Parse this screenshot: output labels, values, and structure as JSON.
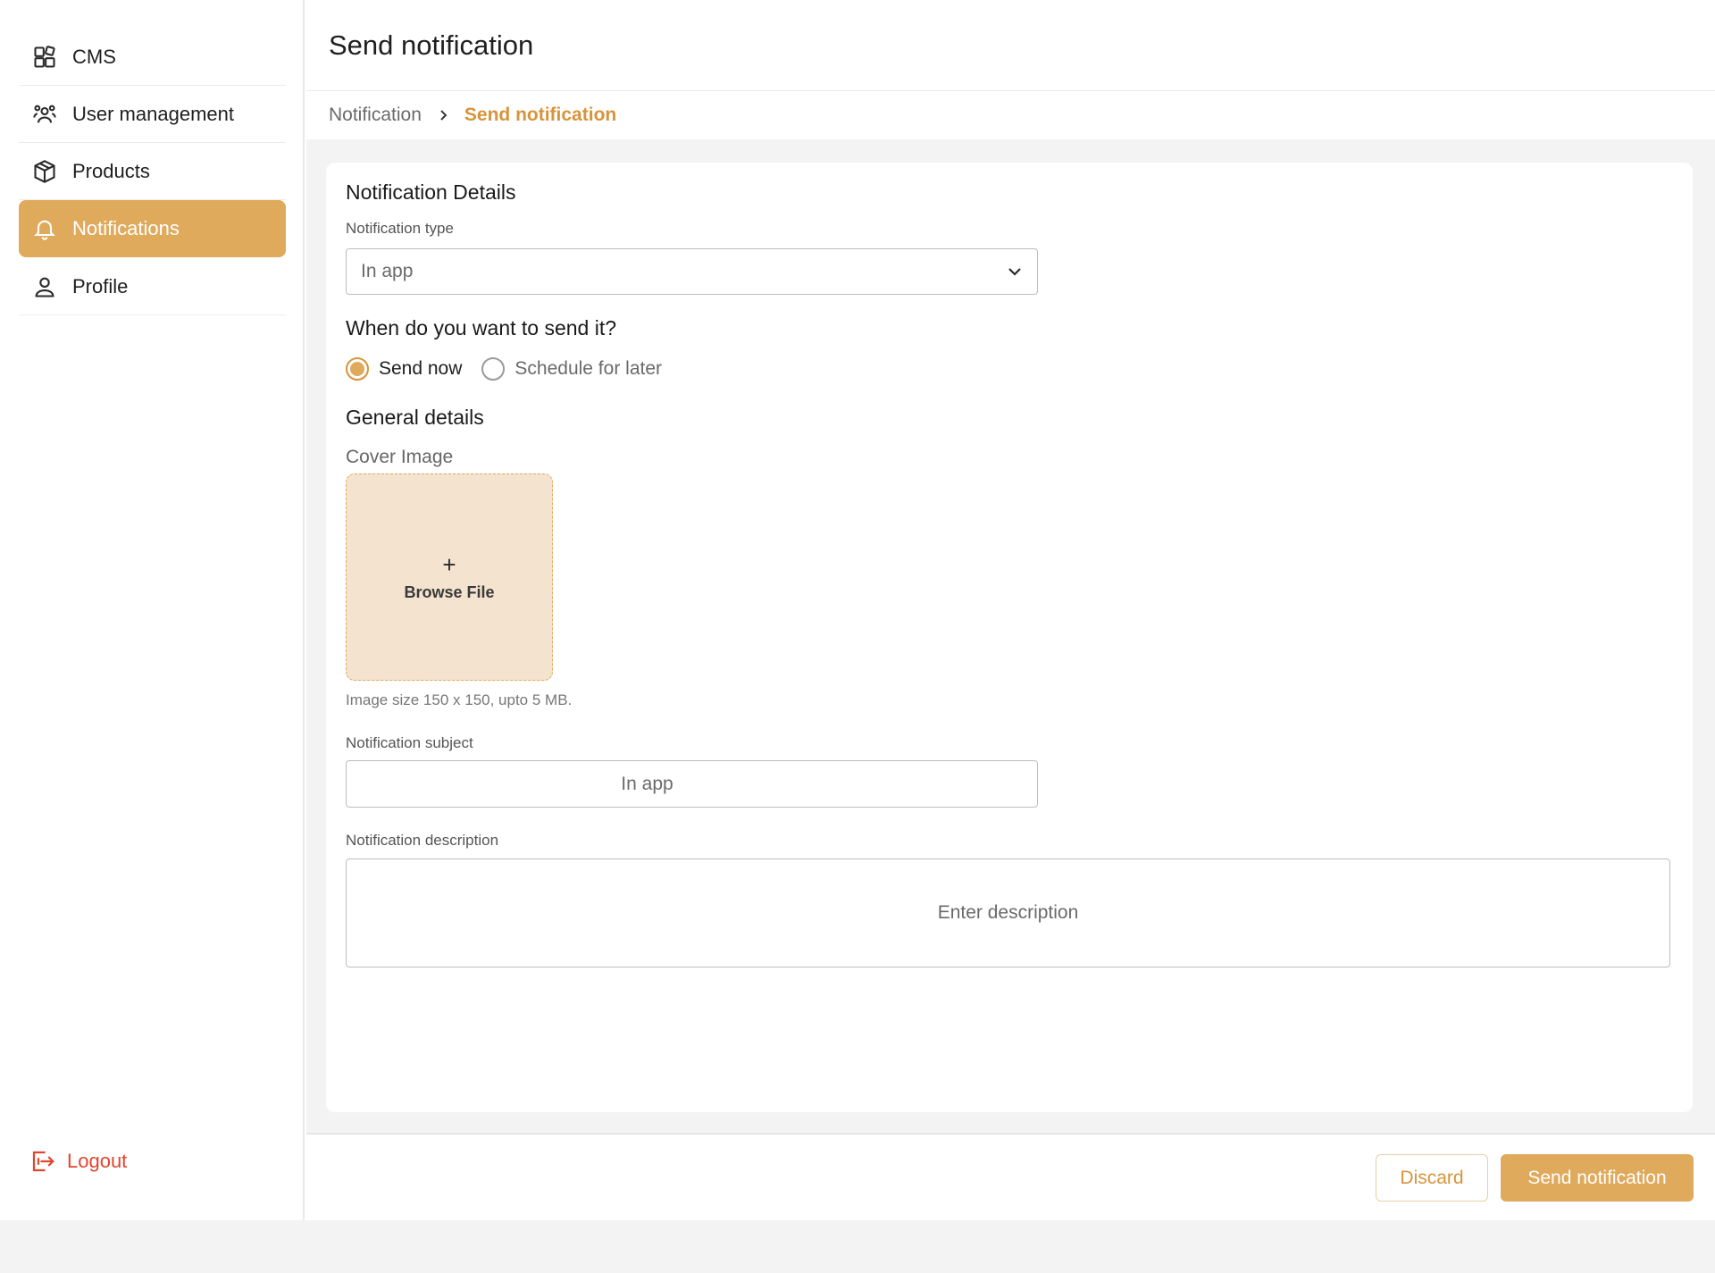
{
  "sidebar": {
    "items": [
      {
        "label": "CMS",
        "icon": "cms-icon"
      },
      {
        "label": "User management",
        "icon": "users-icon"
      },
      {
        "label": "Products",
        "icon": "box-icon"
      },
      {
        "label": "Notifications",
        "icon": "bell-icon",
        "active": true
      },
      {
        "label": "Profile",
        "icon": "user-icon"
      }
    ],
    "logout_label": "Logout"
  },
  "header": {
    "title": "Send notification"
  },
  "breadcrumb": {
    "parent": "Notification",
    "current": "Send notification"
  },
  "form": {
    "details_title": "Notification Details",
    "type_label": "Notification type",
    "type_value": "In app",
    "when_title": "When do you want to send it?",
    "radio_send_now": "Send now",
    "radio_schedule": "Schedule for later",
    "selected_option": "Send now",
    "general_title": "General details",
    "cover_label": "Cover Image",
    "browse_plus": "+",
    "browse_label": "Browse File",
    "image_hint": "Image size 150 x 150, upto 5 MB.",
    "subject_label": "Notification subject",
    "subject_value": "In app",
    "description_label": "Notification description",
    "description_placeholder": "Enter description"
  },
  "footer": {
    "discard_label": "Discard",
    "send_label": "Send notification"
  },
  "colors": {
    "accent": "#e0aa5d",
    "accent_text": "#d8943a",
    "danger": "#e2452f",
    "upload_bg": "#f4e3cf"
  }
}
